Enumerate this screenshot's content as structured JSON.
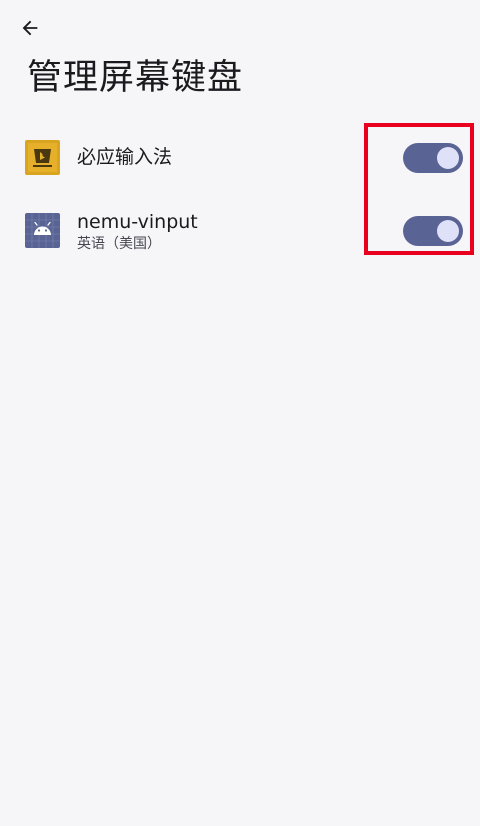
{
  "header": {
    "back_icon": "arrow-back-icon",
    "title": "管理屏幕键盘"
  },
  "keyboards": [
    {
      "name": "必应输入法",
      "subtitle": "",
      "icon": "bing-input-icon",
      "icon_color": "#d9a520",
      "enabled": true
    },
    {
      "name": "nemu-vinput",
      "subtitle": "英语（美国）",
      "icon": "android-icon",
      "icon_color": "#5a6494",
      "enabled": true
    }
  ],
  "colors": {
    "background": "#f6f6f9",
    "toggle_track_on": "#5a6494",
    "toggle_thumb_on": "#dfe1f9",
    "highlight": "#e8001e"
  }
}
